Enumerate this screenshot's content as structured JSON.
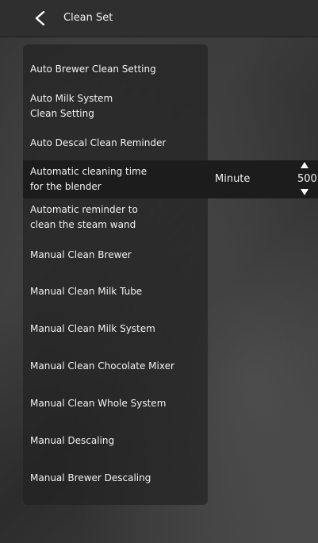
{
  "header": {
    "title": "Clean Set",
    "back_icon": "chevron-left-icon"
  },
  "menu": {
    "items": [
      {
        "line1": "Auto Brewer Clean Setting",
        "line2": ""
      },
      {
        "line1": "Auto Milk System",
        "line2": "Clean Setting"
      },
      {
        "line1": "Auto Descal Clean Reminder",
        "line2": ""
      },
      {
        "line1": "Automatic cleaning time",
        "line2": "for the blender"
      },
      {
        "line1": "Automatic reminder to",
        "line2": "clean the steam wand"
      },
      {
        "line1": "Manual Clean Brewer",
        "line2": ""
      },
      {
        "line1": "Manual Clean Milk Tube",
        "line2": ""
      },
      {
        "line1": "Manual Clean Milk System",
        "line2": ""
      },
      {
        "line1": "Manual Clean Chocolate Mixer",
        "line2": ""
      },
      {
        "line1": "Manual Clean Whole System",
        "line2": ""
      },
      {
        "line1": "Manual Descaling",
        "line2": ""
      },
      {
        "line1": "Manual Brewer Descaling",
        "line2": ""
      }
    ]
  },
  "blender_setting": {
    "unit": "Minute",
    "value": "500",
    "up_icon": "triangle-up-icon",
    "down_icon": "triangle-down-icon"
  }
}
